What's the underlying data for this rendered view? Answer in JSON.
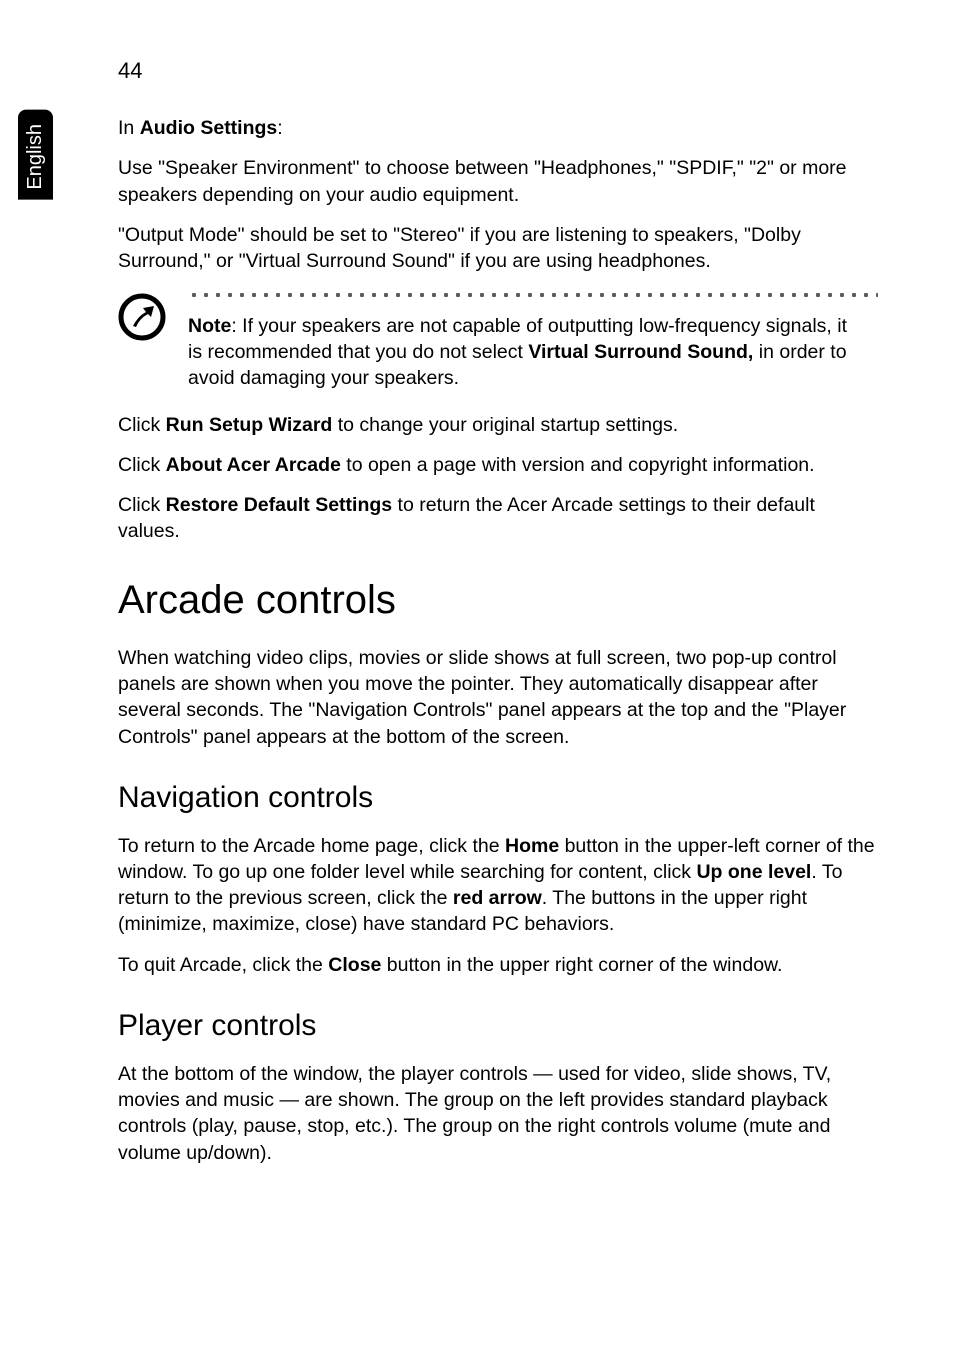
{
  "page_number": "44",
  "side_tab": "English",
  "audio_settings_label": "Audio Settings",
  "in_prefix": "In ",
  "colon": ":",
  "p1": "Use \"Speaker Environment\" to choose between \"Headphones,\" \"SPDIF,\" \"2\" or more speakers depending on your audio equipment.",
  "p2": "\"Output Mode\" should be set to \"Stereo\" if you are listening to speakers, \"Dolby Surround,\" or \"Virtual Surround Sound\" if you are using headphones.",
  "note": {
    "label": "Note",
    "part1": ": If your speakers are not capable of outputting low-frequency signals, it is recommended that you do not select ",
    "bold": "Virtual Surround Sound,",
    "part2": " in order to avoid damaging your speakers."
  },
  "p3_pre": "Click ",
  "p3_b": "Run Setup Wizard",
  "p3_post": " to change your original startup settings.",
  "p4_pre": "Click ",
  "p4_b": "About Acer Arcade",
  "p4_post": " to open a page with version and copyright information.",
  "p5_pre": "Click ",
  "p5_b": "Restore Default Settings",
  "p5_post": " to return the Acer Arcade settings to their default values.",
  "h_arcade": "Arcade controls",
  "arcade_p": "When watching video clips, movies or slide shows at full screen, two pop-up control panels are shown when you move the pointer. They automatically disappear after several seconds. The \"Navigation Controls\" panel appears at the top and the \"Player Controls\" panel appears at the bottom of the screen.",
  "h_nav": "Navigation controls",
  "nav_p1_a": "To return to the Arcade home page, click the ",
  "nav_p1_b1": "Home",
  "nav_p1_c": " button in the upper-left corner of the window. To go up one folder level while searching for content, click ",
  "nav_p1_b2": "Up one level",
  "nav_p1_d": ". To return to the previous screen, click the ",
  "nav_p1_b3": "red arrow",
  "nav_p1_e": ". The buttons in the upper right (minimize, maximize, close) have standard PC behaviors.",
  "nav_p2_a": "To quit Arcade, click the ",
  "nav_p2_b": "Close",
  "nav_p2_c": " button in the upper right corner of the window.",
  "h_player": "Player controls",
  "player_p": "At the bottom of the window, the player controls — used for video, slide shows, TV, movies and music — are shown. The group on the left provides standard playback controls (play, pause, stop, etc.). The group on the right controls volume (mute and volume up/down)."
}
